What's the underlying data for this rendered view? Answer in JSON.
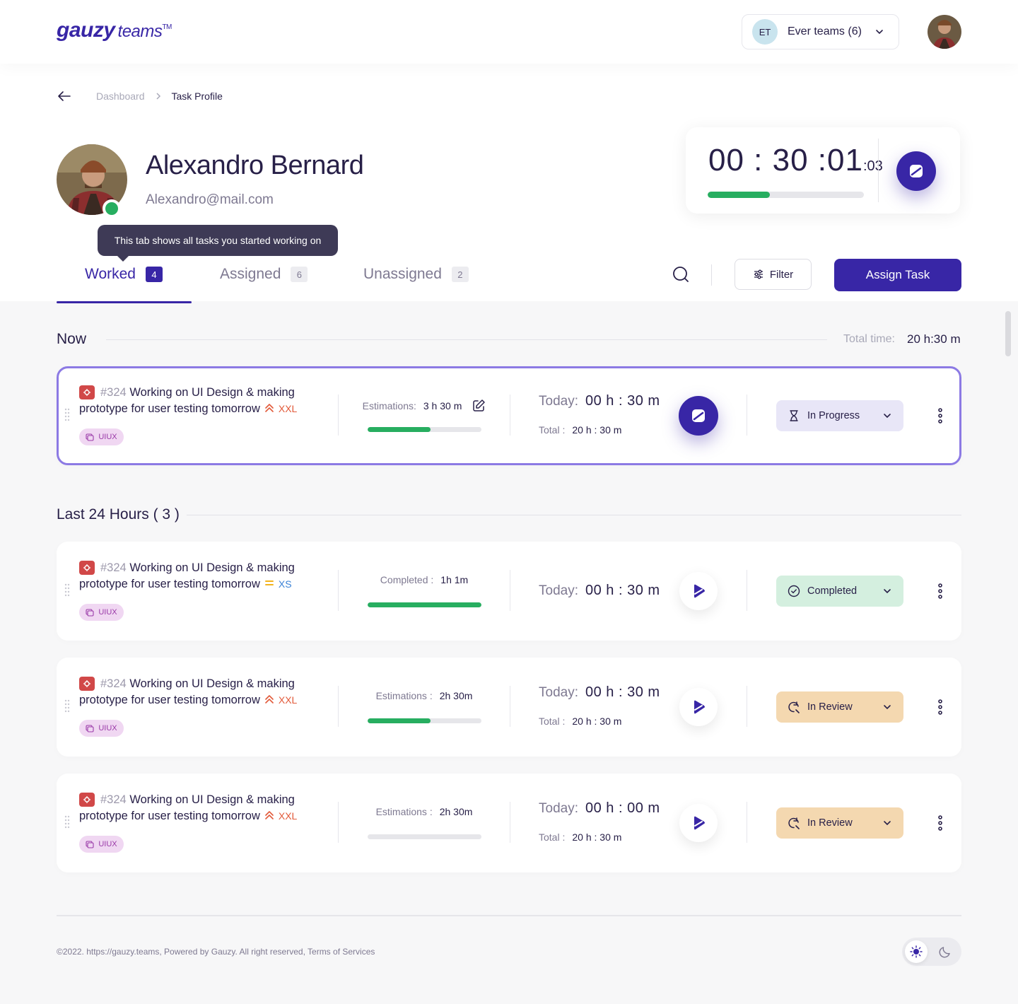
{
  "header": {
    "logo_main": "gauzy",
    "logo_sub": "teams",
    "logo_tm": "TM",
    "team": {
      "initials": "ET",
      "name": "Ever teams (6)"
    }
  },
  "breadcrumb": {
    "parent": "Dashboard",
    "current": "Task Profile"
  },
  "profile": {
    "name": "Alexandro Bernard",
    "email": "Alexandro@mail.com",
    "online": true
  },
  "timer": {
    "main": "00 : 30 :01",
    "ms": ":03",
    "progress": 0.4
  },
  "tooltip": "This tab shows all tasks you started working on",
  "tabs": [
    {
      "label": "Worked",
      "count": "4",
      "active": true
    },
    {
      "label": "Assigned",
      "count": "6",
      "active": false
    },
    {
      "label": "Unassigned",
      "count": "2",
      "active": false
    }
  ],
  "toolbar": {
    "filter_label": "Filter",
    "assign_label": "Assign Task"
  },
  "now_section": {
    "title": "Now",
    "total_label": "Total time:",
    "total_value": "20 h:30 m"
  },
  "last_section": {
    "title": "Last 24 Hours ( 3 )"
  },
  "tasks": [
    {
      "number": "#324",
      "title": "Working on UI Design & making prototype for user testing tomorrow",
      "priority": "high",
      "size": "XXL",
      "tag": "UIUX",
      "est_label": "Estimations:",
      "est_value": "3 h 30 m",
      "progress": 0.55,
      "today_label": "Today:",
      "today_value": "00 h : 30 m",
      "total_label": "Total :",
      "total_value": "20 h : 30 m",
      "running": true,
      "status": "In Progress"
    },
    {
      "number": "#324",
      "title": "Working on UI Design & making prototype for user testing tomorrow",
      "priority": "medium",
      "size": "XS",
      "tag": "UIUX",
      "est_label": "Completed :",
      "est_value": "1h 1m",
      "progress": 1.0,
      "today_label": "Today:",
      "today_value": "00 h : 30 m",
      "running": false,
      "status": "Completed"
    },
    {
      "number": "#324",
      "title": "Working on UI Design & making prototype for user testing tomorrow",
      "priority": "high",
      "size": "XXL",
      "tag": "UIUX",
      "est_label": "Estimations :",
      "est_value": "2h 30m",
      "progress": 0.55,
      "today_label": "Today:",
      "today_value": "00 h : 30 m",
      "total_label": "Total :",
      "total_value": "20 h : 30 m",
      "running": false,
      "status": "In Review"
    },
    {
      "number": "#324",
      "title": "Working on UI Design & making prototype for user testing tomorrow",
      "priority": "high",
      "size": "XXL",
      "tag": "UIUX",
      "est_label": "Estimations :",
      "est_value": "2h 30m",
      "progress": 0.0,
      "today_label": "Today:",
      "today_value": "00 h : 00 m",
      "total_label": "Total :",
      "total_value": "20 h : 30 m",
      "running": false,
      "status": "In Review"
    }
  ],
  "footer": {
    "text": "©2022. https://gauzy.teams, Powered by Gauzy. All right reserved, Terms of Services"
  },
  "colors": {
    "accent": "#3826a6",
    "progress": "#27ae60",
    "online": "#27ae60",
    "bug": "#d14848",
    "priority_high": "#e25a3a",
    "priority_medium": "#f2b31d",
    "size_xs": "#3b82d6",
    "status_in_progress": "#e8e6f7",
    "status_completed": "#d4efdf",
    "status_in_review": "#f4d8b0"
  },
  "icons": [
    "back-arrow-icon",
    "chevron-right-icon",
    "chevron-down-icon",
    "stop-icon",
    "play-icon",
    "search-icon",
    "filter-icon",
    "bug-icon",
    "priority-high-icon",
    "priority-medium-icon",
    "tag-icon",
    "edit-icon",
    "hourglass-icon",
    "check-circle-icon",
    "review-icon",
    "more-vertical-icon",
    "drag-handle-icon",
    "sun-icon",
    "moon-icon"
  ]
}
